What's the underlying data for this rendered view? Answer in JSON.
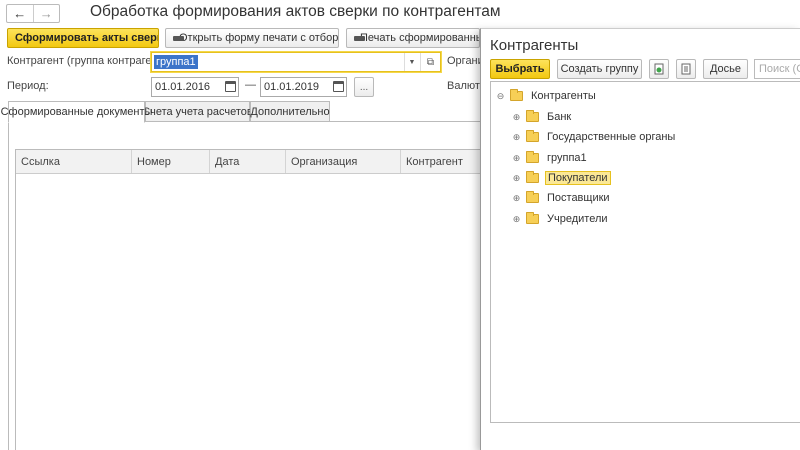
{
  "form": {
    "title": "Обработка формирования актов сверки по контрагентам",
    "nav": {
      "back_icon": "←",
      "forward_icon": "→"
    },
    "toolbar": {
      "generate_label": "Сформировать акты сверки",
      "open_print_label": "Открыть форму печати с отборами",
      "print_generated_label": "Печать сформированных д"
    },
    "counterparty": {
      "label": "Контрагент (группа контрагентов):",
      "value": "группа1",
      "dropdown_icon": "▼",
      "open_icon": "⧉"
    },
    "organization_label": "Организ",
    "period": {
      "label": "Период:",
      "from": "01.01.2016",
      "to": "01.01.2019",
      "dash": "—",
      "more": "..."
    },
    "currency_label": "Валюта",
    "tabs": [
      {
        "label": "Сформированные документы"
      },
      {
        "label": "Счета учета расчетов"
      },
      {
        "label": "Дополнительно"
      }
    ],
    "table": {
      "columns": [
        "Ссылка",
        "Номер",
        "Дата",
        "Организация",
        "Контрагент"
      ]
    }
  },
  "dialog": {
    "title": "Контрагенты",
    "select_label": "Выбрать",
    "create_group_label": "Создать группу",
    "dossier_label": "Досье",
    "search_placeholder": "Поиск (Ctrl",
    "tree": {
      "root": {
        "label": "Контрагенты",
        "expander": "⊖"
      },
      "items": [
        {
          "label": "Банк",
          "expander": "⊕"
        },
        {
          "label": "Государственные органы",
          "expander": "⊕"
        },
        {
          "label": "группа1",
          "expander": "⊕"
        },
        {
          "label": "Покупатели",
          "expander": "⊕"
        },
        {
          "label": "Поставщики",
          "expander": "⊕"
        },
        {
          "label": "Учредители",
          "expander": "⊕"
        }
      ]
    }
  },
  "colors": {
    "accent_yellow": "#f5d21f",
    "selection_blue": "#3c74c9",
    "selected_row": "#fbe896"
  }
}
